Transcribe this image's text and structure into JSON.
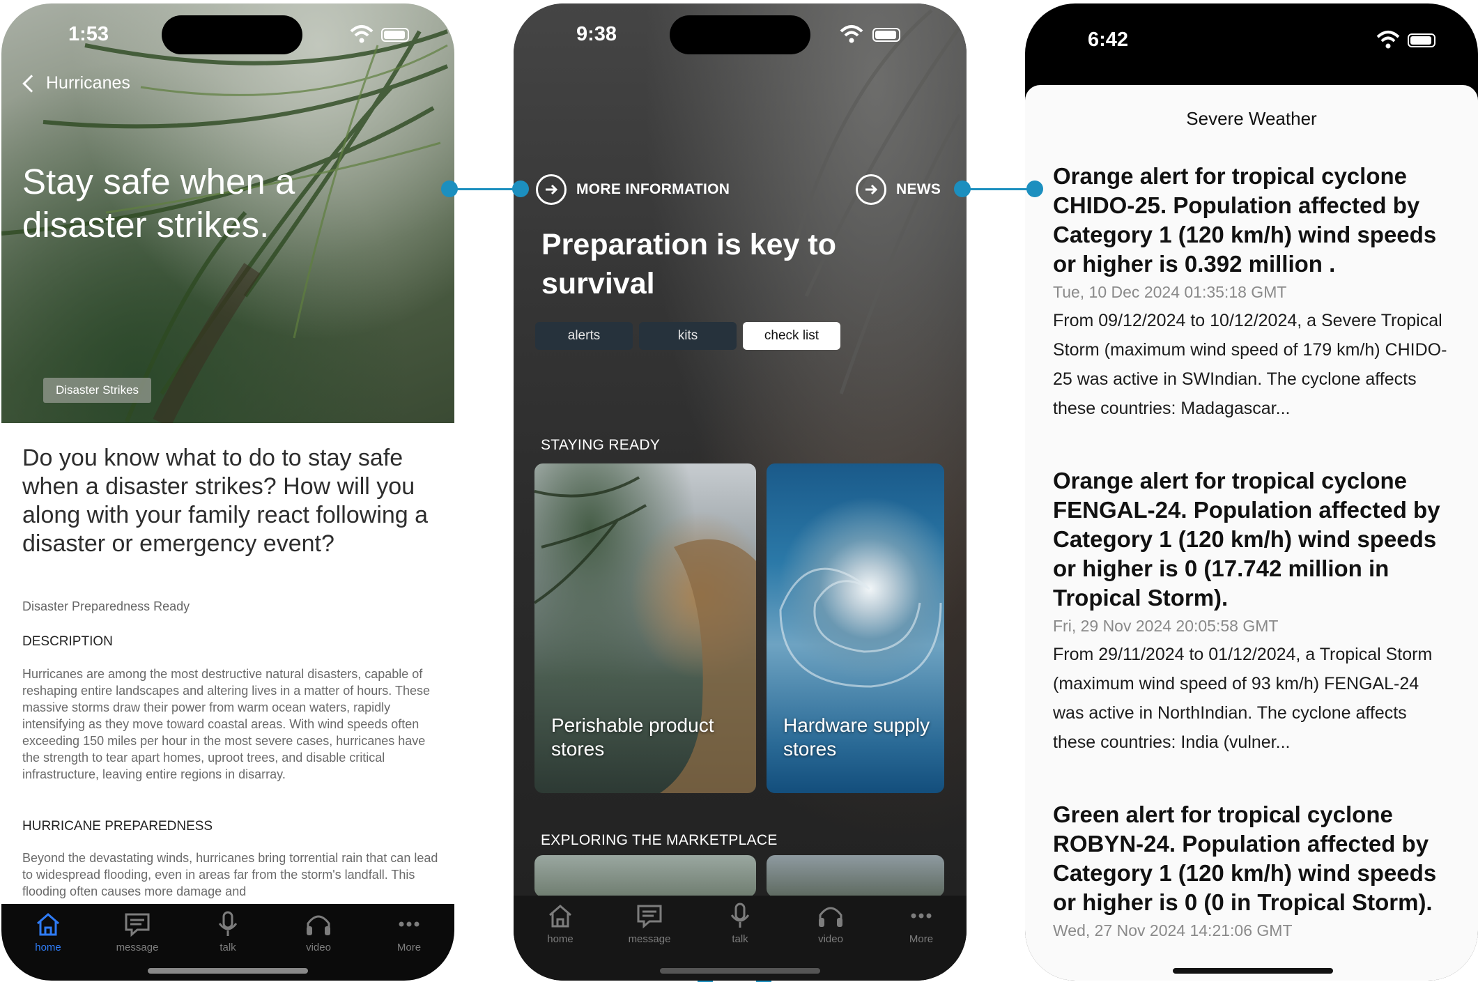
{
  "phone1": {
    "status_time": "1:53",
    "back_label": "Hurricanes",
    "hero_title": "Stay safe when a disaster strikes.",
    "hero_tag": "Disaster Strikes",
    "question": "Do you know what to do to stay safe when a disaster strikes? How will you along with your family react following a disaster or emergency event?",
    "subtitle": "Disaster Preparedness Ready",
    "description_heading": "DESCRIPTION",
    "description_text": "Hurricanes are among the most destructive natural disasters, capable of reshaping entire landscapes and altering lives in a matter of hours. These massive storms draw their power from warm ocean waters, rapidly intensifying as they move toward coastal areas. With wind speeds often exceeding 150 miles per hour in the most severe cases, hurricanes have the strength to tear apart homes, uproot trees, and disable critical infrastructure, leaving entire regions in disarray.",
    "preparedness_heading": "HURRICANE PREPAREDNESS",
    "preparedness_text": "Beyond the devastating winds, hurricanes bring torrential rain that can lead to widespread flooding, even in areas far from the storm's landfall. This flooding often causes more damage and",
    "tabs": [
      {
        "label": "home",
        "icon": "house-icon"
      },
      {
        "label": "message",
        "icon": "message-icon"
      },
      {
        "label": "talk",
        "icon": "microphone-icon"
      },
      {
        "label": "video",
        "icon": "headphones-icon"
      },
      {
        "label": "More",
        "icon": "more-dots-icon"
      }
    ]
  },
  "phone2": {
    "status_time": "9:38",
    "more_info_label": "MORE INFORMATION",
    "news_label": "NEWS",
    "title": "Preparation is key to survival",
    "segments": [
      "alerts",
      "kits",
      "check list"
    ],
    "selected_segment": "check list",
    "staying_ready_label": "STAYING READY",
    "cards": [
      {
        "caption": "Perishable product stores"
      },
      {
        "caption": "Hardware supply stores"
      }
    ],
    "marketplace_label": "EXPLORING THE MARKETPLACE",
    "tabs": [
      {
        "label": "home",
        "icon": "house-icon"
      },
      {
        "label": "message",
        "icon": "message-icon"
      },
      {
        "label": "talk",
        "icon": "microphone-icon"
      },
      {
        "label": "video",
        "icon": "headphones-icon"
      },
      {
        "label": "More",
        "icon": "more-dots-icon"
      }
    ]
  },
  "phone3": {
    "status_time": "6:42",
    "sheet_title": "Severe Weather",
    "alerts": [
      {
        "headline": "Orange alert for tropical cyclone CHIDO-25. Population affected by Category 1 (120 km/h) wind speeds or higher is 0.392 million .",
        "date": "Tue, 10 Dec 2024 01:35:18 GMT",
        "body": "From 09/12/2024 to 10/12/2024, a Severe Tropical Storm (maximum wind speed of 179 km/h) CHIDO-25 was active in SWIndian. The cyclone affects these countries: Madagascar..."
      },
      {
        "headline": "Orange alert for tropical cyclone FENGAL-24. Population affected by Category 1 (120 km/h) wind speeds or higher is 0  (17.742 million in Tropical Storm).",
        "date": "Fri, 29 Nov 2024 20:05:58 GMT",
        "body": "From 29/11/2024 to 01/12/2024, a Tropical Storm (maximum wind speed of 93 km/h) FENGAL-24 was active in NorthIndian. The cyclone affects these countries: India (vulner..."
      },
      {
        "headline": "Green alert for tropical cyclone ROBYN-24. Population affected by Category 1 (120 km/h) wind speeds or higher is 0  (0 in Tropical Storm).",
        "date": "Wed, 27 Nov 2024 14:21:06 GMT",
        "body": ""
      }
    ]
  },
  "colors": {
    "connector": "#1c8fbf",
    "active_tab": "#2f7cf6",
    "segment_off": "#26323c"
  }
}
